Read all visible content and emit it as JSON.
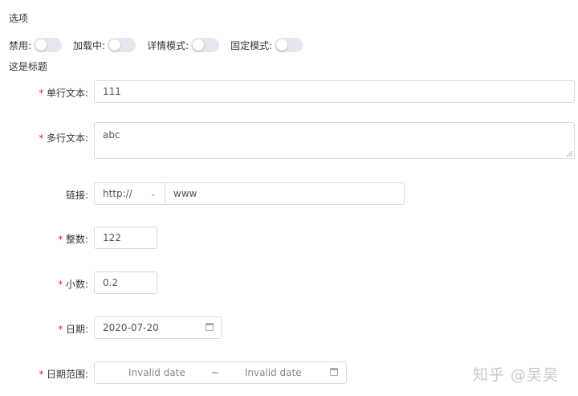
{
  "options": {
    "title": "选项",
    "switches": [
      {
        "label": "禁用:",
        "on": false
      },
      {
        "label": "加载中:",
        "on": false
      },
      {
        "label": "详情模式:",
        "on": false
      },
      {
        "label": "固定模式:",
        "on": false
      }
    ]
  },
  "form": {
    "title": "这是标题",
    "required_mark": "*",
    "single_text": {
      "label": "单行文本:",
      "value": "111",
      "required": true
    },
    "multi_text": {
      "label": "多行文本:",
      "value": "abc",
      "required": true
    },
    "link": {
      "label": "链接:",
      "protocol": "http://",
      "value": "www",
      "required": false
    },
    "integer": {
      "label": "整数:",
      "value": "122",
      "required": true
    },
    "decimal": {
      "label": "小数:",
      "value": "0.2",
      "required": true
    },
    "date": {
      "label": "日期:",
      "value": "2020-07-20",
      "required": true
    },
    "date_range": {
      "label": "日期范围:",
      "start": "Invalid date",
      "separator": "~",
      "end": "Invalid date",
      "required": true
    }
  },
  "watermark": "知乎 @吴昊",
  "icons": {
    "select_arrow": "chevron-down-icon",
    "date": "calendar-icon"
  }
}
